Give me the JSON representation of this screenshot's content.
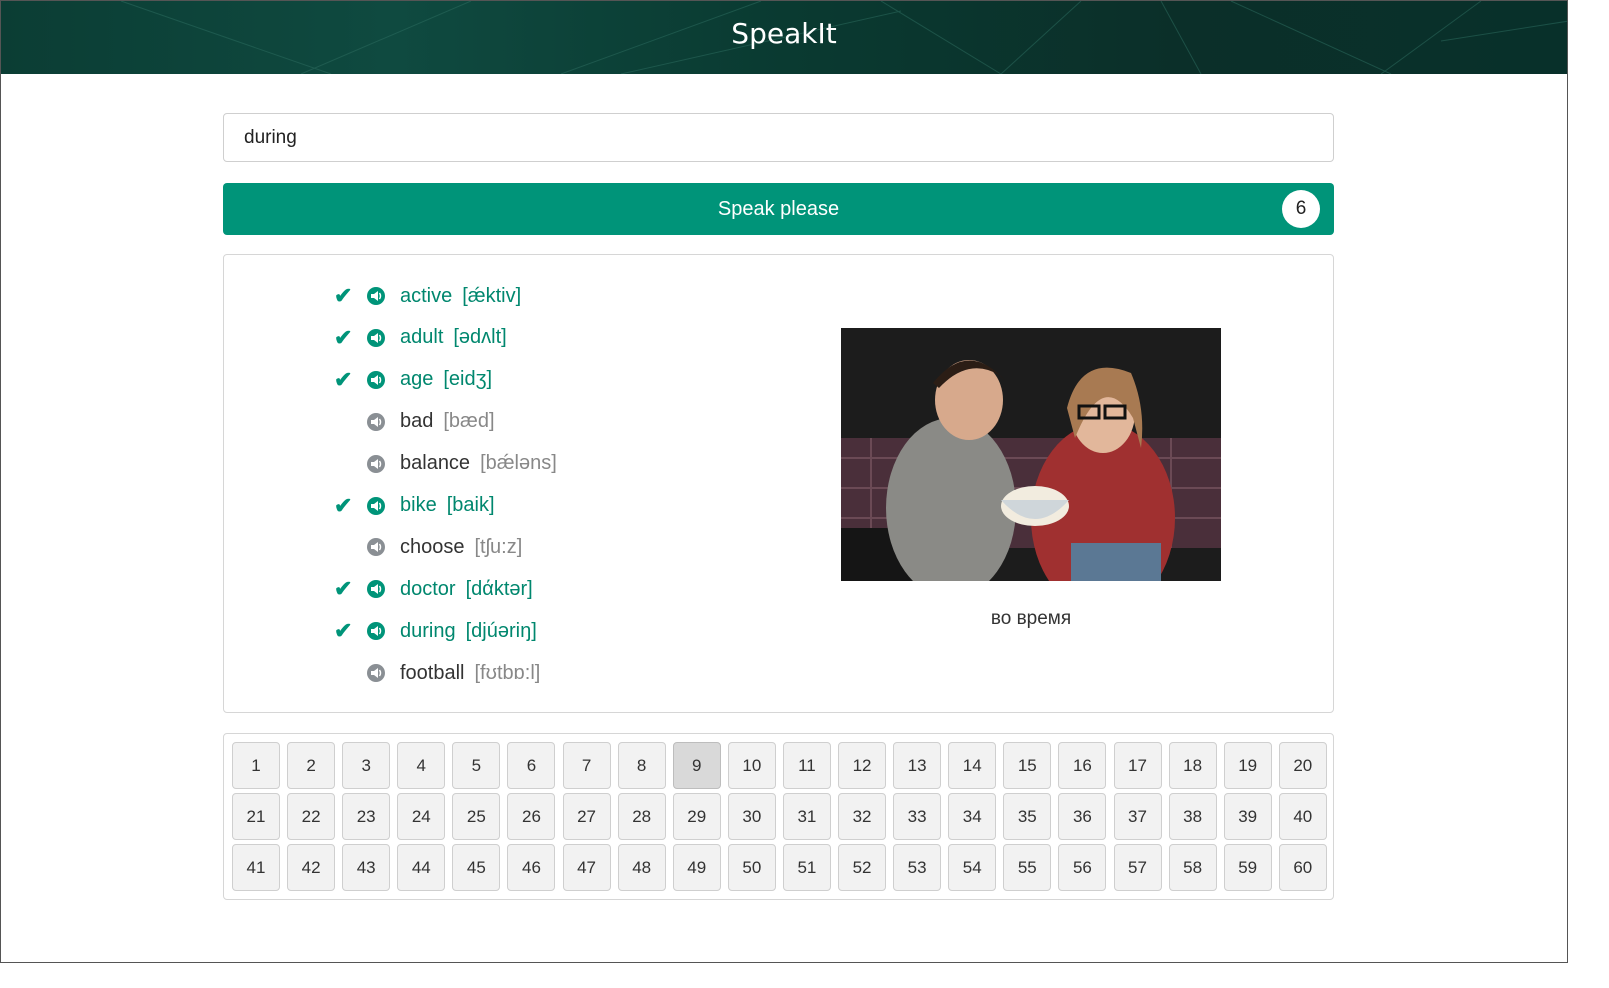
{
  "app": {
    "title": "SpeakIt"
  },
  "search": {
    "value": "during"
  },
  "speak": {
    "label": "Speak please",
    "score": "6"
  },
  "words": [
    {
      "word": "active",
      "transcription": "[ǽktiv]",
      "learned": true
    },
    {
      "word": "adult",
      "transcription": "[ədʌlt]",
      "learned": true
    },
    {
      "word": "age",
      "transcription": "[eidʒ]",
      "learned": true
    },
    {
      "word": "bad",
      "transcription": "[bæd]",
      "learned": false
    },
    {
      "word": "balance",
      "transcription": "[bǽləns]",
      "learned": false
    },
    {
      "word": "bike",
      "transcription": "[baik]",
      "learned": true
    },
    {
      "word": "choose",
      "transcription": "[tʃu:z]",
      "learned": false
    },
    {
      "word": "doctor",
      "transcription": "[dάktər]",
      "learned": true
    },
    {
      "word": "during",
      "transcription": "[djúəriŋ]",
      "learned": true
    },
    {
      "word": "football",
      "transcription": "[fʊtbɒ:l]",
      "learned": false
    }
  ],
  "current": {
    "translation": "во время"
  },
  "pagination": {
    "active": 9,
    "pages": [
      1,
      2,
      3,
      4,
      5,
      6,
      7,
      8,
      9,
      10,
      11,
      12,
      13,
      14,
      15,
      16,
      17,
      18,
      19,
      20,
      21,
      22,
      23,
      24,
      25,
      26,
      27,
      28,
      29,
      30,
      31,
      32,
      33,
      34,
      35,
      36,
      37,
      38,
      39,
      40,
      41,
      42,
      43,
      44,
      45,
      46,
      47,
      48,
      49,
      50,
      51,
      52,
      53,
      54,
      55,
      56,
      57,
      58,
      59,
      60
    ]
  },
  "colors": {
    "accent": "#009479",
    "header": "#0b3d34"
  },
  "icons": {
    "learned": "check-icon",
    "audio": "speaker-icon"
  }
}
